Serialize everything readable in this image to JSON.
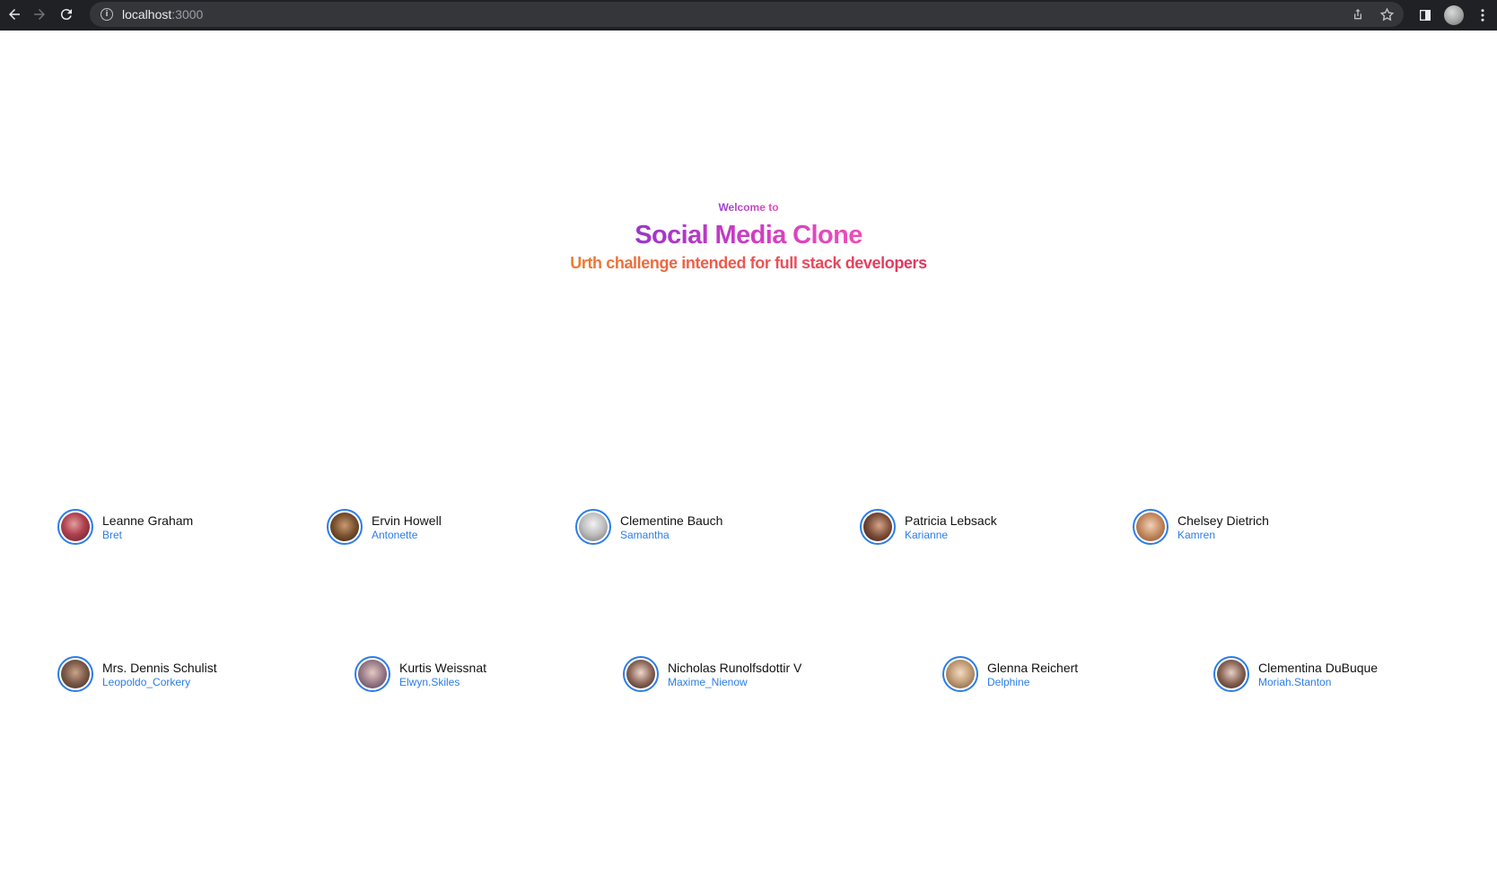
{
  "browser": {
    "url_host": "localhost",
    "url_port": ":3000"
  },
  "hero": {
    "welcome": "Welcome to",
    "title": "Social Media Clone",
    "subtitle": "Urth challenge intended for full stack developers"
  },
  "colors": {
    "accent": "#2b7de9",
    "title_gradient": [
      "#9a35c9",
      "#ec4fb8"
    ],
    "subtitle_gradient": [
      "#f07a2c",
      "#e2355f"
    ]
  },
  "users": [
    {
      "name": "Leanne Graham",
      "username": "Bret"
    },
    {
      "name": "Ervin Howell",
      "username": "Antonette"
    },
    {
      "name": "Clementine Bauch",
      "username": "Samantha"
    },
    {
      "name": "Patricia Lebsack",
      "username": "Karianne"
    },
    {
      "name": "Chelsey Dietrich",
      "username": "Kamren"
    },
    {
      "name": "Mrs. Dennis Schulist",
      "username": "Leopoldo_Corkery"
    },
    {
      "name": "Kurtis Weissnat",
      "username": "Elwyn.Skiles"
    },
    {
      "name": "Nicholas Runolfsdottir V",
      "username": "Maxime_Nienow"
    },
    {
      "name": "Glenna Reichert",
      "username": "Delphine"
    },
    {
      "name": "Clementina DuBuque",
      "username": "Moriah.Stanton"
    }
  ]
}
